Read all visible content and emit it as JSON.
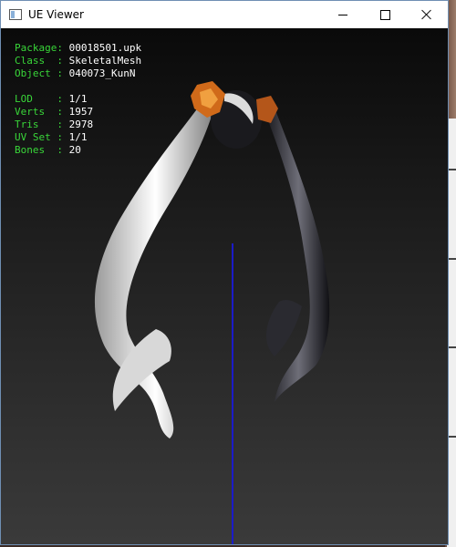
{
  "window": {
    "title": "UE Viewer",
    "controls": [
      "minimize",
      "maximize",
      "close"
    ]
  },
  "info": {
    "rows": [
      {
        "label": "Package:",
        "value": "00018501.upk"
      },
      {
        "label": "Class  :",
        "value": "SkeletalMesh"
      },
      {
        "label": "Object :",
        "value": "040073_KunN"
      }
    ],
    "stats": [
      {
        "label": "LOD    :",
        "value": "1/1"
      },
      {
        "label": "Verts  :",
        "value": "1957"
      },
      {
        "label": "Tris   :",
        "value": "2978"
      },
      {
        "label": "UV Set :",
        "value": "1/1"
      },
      {
        "label": "Bones  :",
        "value": "20"
      }
    ]
  },
  "colors": {
    "label": "#39d639",
    "value": "#ffffff",
    "axis": "#1b1bc8",
    "viewport_top": "#0a0a0a",
    "viewport_bottom": "#3a3a3a",
    "ornament": "#d06a1a"
  },
  "icons": {
    "app": "app-window-icon",
    "minimize": "minimize-icon",
    "maximize": "maximize-icon",
    "close": "close-icon"
  }
}
